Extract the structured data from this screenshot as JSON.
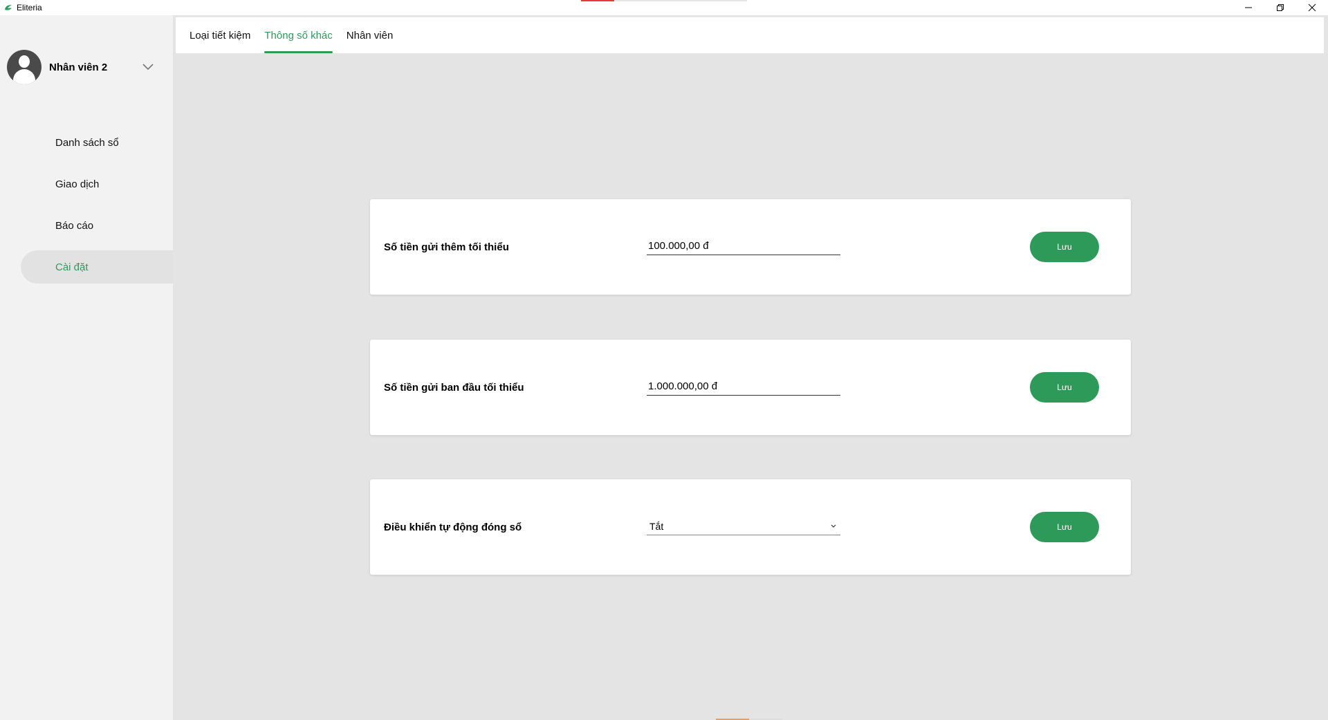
{
  "window": {
    "title": "Eliteria",
    "controls": [
      "minimize-icon",
      "restore-icon",
      "close-icon"
    ]
  },
  "user": {
    "name": "Nhân viên 2"
  },
  "sidebar": {
    "items": [
      {
        "label": "Danh sách sổ"
      },
      {
        "label": "Giao dịch"
      },
      {
        "label": "Báo cáo"
      },
      {
        "label": "Cài đặt",
        "active": true
      }
    ]
  },
  "tabs": [
    {
      "label": "Loại tiết kiệm"
    },
    {
      "label": "Thông số khác",
      "active": true
    },
    {
      "label": "Nhân viên"
    }
  ],
  "settings": {
    "min_additional": {
      "label": "Số tiền gửi thêm tối thiểu",
      "value": "100.000,00 đ",
      "save_label": "Lưu"
    },
    "min_initial": {
      "label": "Số tiền gửi ban đầu tối thiểu",
      "value": "1.000.000,00 đ",
      "save_label": "Lưu"
    },
    "auto_close": {
      "label": "Điều khiển tự động đóng sổ",
      "value": "Tắt",
      "save_label": "Lưu"
    }
  },
  "colors": {
    "accent": "#2e9a5a",
    "sidebar_bg": "#f2f2f2",
    "main_bg": "#e4e4e4"
  }
}
